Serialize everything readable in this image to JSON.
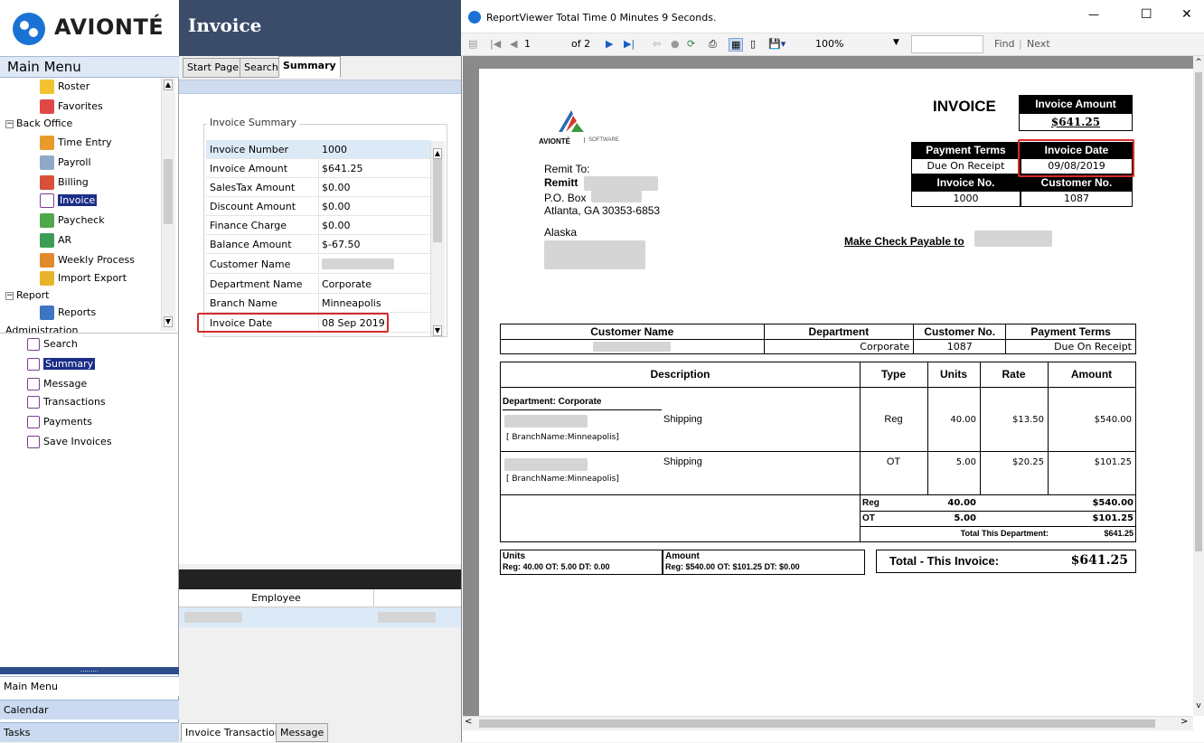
{
  "app": {
    "logo_text": "AVIONTÉ",
    "main_menu_title": "Main Menu",
    "tree": {
      "items": [
        {
          "label": "Roster"
        },
        {
          "label": "Favorites"
        }
      ],
      "back_office": {
        "label": "Back Office",
        "items": [
          "Time Entry",
          "Payroll",
          "Billing",
          "Invoice",
          "Paycheck",
          "AR",
          "Weekly Process",
          "Import Export"
        ]
      },
      "report": {
        "label": "Report",
        "items": [
          "Reports"
        ]
      },
      "administration_label": "Administration"
    },
    "sub_list": [
      "Search",
      "Summary",
      "Message",
      "Transactions",
      "Payments",
      "Save Invoices"
    ],
    "bottom_nav": [
      "Main Menu",
      "Calendar",
      "Tasks"
    ],
    "grip": "........."
  },
  "invoice_panel": {
    "header_title": "Invoice",
    "tabs": [
      "Start Page",
      "Search",
      "Summary"
    ],
    "summary_title": "Invoice Summary",
    "rows": [
      {
        "label": "Invoice Number",
        "value": "1000"
      },
      {
        "label": "Invoice Amount",
        "value": "$641.25"
      },
      {
        "label": "SalesTax Amount",
        "value": "$0.00"
      },
      {
        "label": "Discount Amount",
        "value": "$0.00"
      },
      {
        "label": "Finance Charge",
        "value": "$0.00"
      },
      {
        "label": "Balance Amount",
        "value": "$-67.50"
      },
      {
        "label": "Customer Name",
        "value": ""
      },
      {
        "label": "Department Name",
        "value": "Corporate"
      },
      {
        "label": "Branch Name",
        "value": "Minneapolis"
      },
      {
        "label": "Invoice Date",
        "value": "08 Sep 2019"
      }
    ],
    "employee_header": "Employee",
    "bottom_tabs": [
      "Invoice Transaction",
      "Message"
    ]
  },
  "report_viewer": {
    "title": "ReportViewer  Total Time 0 Minutes 9 Seconds.",
    "page_current": "1",
    "page_of": "of 2",
    "zoom": "100%",
    "find_label": "Find",
    "next_label": "Next",
    "window_controls": {
      "minimize": "—",
      "maximize": "☐",
      "close": "✕"
    }
  },
  "invoice_doc": {
    "logo_brand": "AVIONTÉ",
    "logo_sub": "SOFTWARE",
    "title": "INVOICE",
    "invoice_amount_label": "Invoice Amount",
    "invoice_amount_value": "$641.25",
    "payment_terms_label": "Payment Terms",
    "payment_terms_value": "Due On Receipt",
    "invoice_date_label": "Invoice Date",
    "invoice_date_value": "09/08/2019",
    "invoice_no_label": "Invoice No.",
    "invoice_no_value": "1000",
    "customer_no_label": "Customer No.",
    "customer_no_value": "1087",
    "remit_to": "Remit To:",
    "remit_name": "Remitt",
    "po_box": "P.O. Box",
    "city": "Atlanta, GA 30353-6853",
    "bill_to": "Alaska",
    "make_check": "Make Check Payable to",
    "cust_table": {
      "headers": [
        "Customer Name",
        "Department",
        "Customer No.",
        "Payment Terms"
      ],
      "row": [
        "",
        "Corporate",
        "1087",
        "Due On Receipt"
      ]
    },
    "detail_table": {
      "headers": [
        "Description",
        "Type",
        "Units",
        "Rate",
        "Amount"
      ],
      "department_label": "Department: Corporate",
      "lines": [
        {
          "desc": "Shipping",
          "branch": "[ BranchName:Minneapolis]",
          "type": "Reg",
          "units": "40.00",
          "rate": "$13.50",
          "amount": "$540.00"
        },
        {
          "desc": "Shipping",
          "branch": "[ BranchName:Minneapolis]",
          "type": "OT",
          "units": "5.00",
          "rate": "$20.25",
          "amount": "$101.25"
        }
      ],
      "subtotals": [
        {
          "type": "Reg",
          "units": "40.00",
          "amount": "$540.00"
        },
        {
          "type": "OT",
          "units": "5.00",
          "amount": "$101.25"
        }
      ],
      "total_dept_label": "Total This Department:",
      "total_dept_value": "$641.25"
    },
    "summary": {
      "units_label": "Units",
      "units_value": "Reg: 40.00 OT: 5.00 DT: 0.00",
      "amount_label": "Amount",
      "amount_value": "Reg: $540.00 OT: $101.25 DT: $0.00",
      "total_label": "Total - This Invoice:",
      "total_value": "$641.25"
    }
  }
}
